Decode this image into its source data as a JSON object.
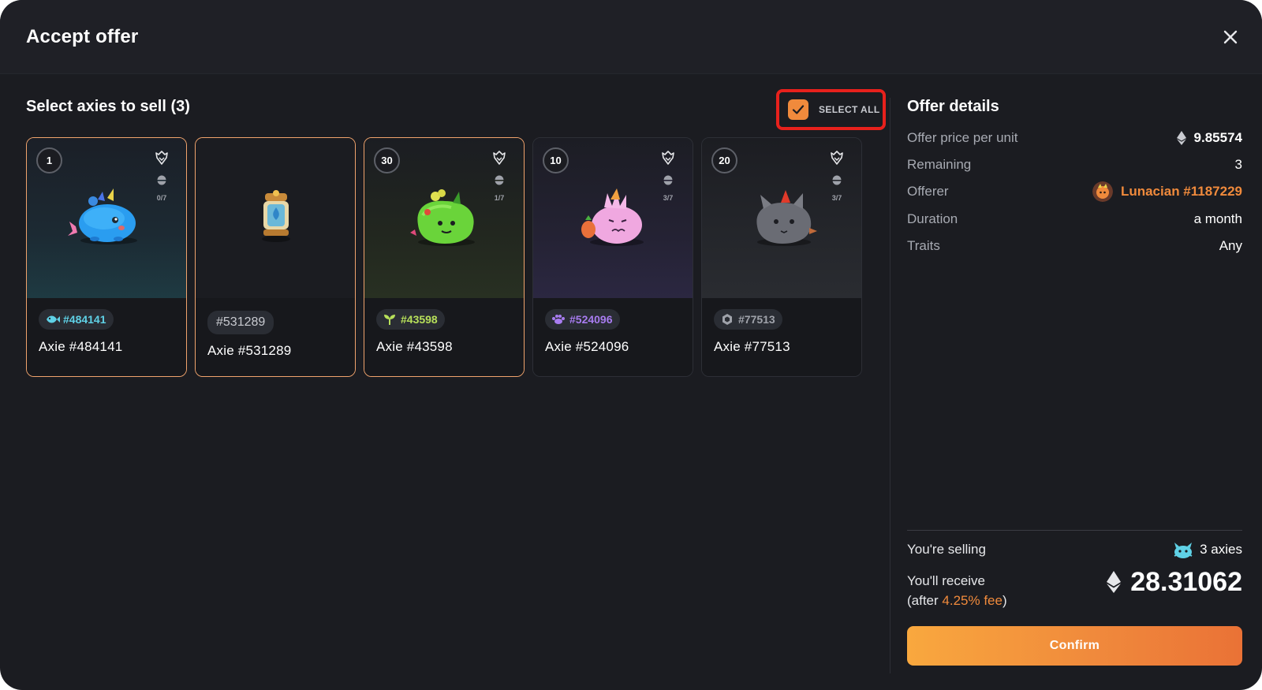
{
  "modal": {
    "title": "Accept offer",
    "close_icon": "close-icon"
  },
  "selection": {
    "title": "Select axies to sell (3)",
    "select_all_label": "SELECT ALL",
    "select_all_checked": true
  },
  "cards": [
    {
      "level": "1",
      "badge_id": "#484141",
      "badge_color": "#5fd1e6",
      "class_icon": "aquatic-fish-icon",
      "name": "Axie #484141",
      "breed_count": "0/7",
      "selected": true,
      "kind": "axie"
    },
    {
      "level": "",
      "badge_id": "#531289",
      "badge_color": "#c8cad0",
      "class_icon": "",
      "name": "Axie #531289",
      "breed_count": "",
      "selected": true,
      "kind": "egg-lantern"
    },
    {
      "level": "30",
      "badge_id": "#43598",
      "badge_color": "#b7e05a",
      "class_icon": "plant-sprout-icon",
      "name": "Axie #43598",
      "breed_count": "1/7",
      "selected": true,
      "kind": "axie"
    },
    {
      "level": "10",
      "badge_id": "#524096",
      "badge_color": "#a87cf0",
      "class_icon": "bug-paw-icon",
      "name": "Axie #524096",
      "breed_count": "3/7",
      "selected": false,
      "kind": "axie"
    },
    {
      "level": "20",
      "badge_id": "#77513",
      "badge_color": "#9fa2aa",
      "class_icon": "mech-hexagon-icon",
      "name": "Axie #77513",
      "breed_count": "3/7",
      "selected": false,
      "kind": "axie"
    }
  ],
  "offer": {
    "title": "Offer details",
    "price_label": "Offer price per unit",
    "price_value": "9.85574",
    "remaining_label": "Remaining",
    "remaining_value": "3",
    "offerer_label": "Offerer",
    "offerer_value": "Lunacian #1187229",
    "duration_label": "Duration",
    "duration_value": "a month",
    "traits_label": "Traits",
    "traits_value": "Any"
  },
  "summary": {
    "selling_label": "You're selling",
    "selling_value": "3 axies",
    "receive_label_line1": "You'll receive",
    "receive_label_prefix": "(after ",
    "fee_pct": "4.25% fee",
    "receive_label_suffix": ")",
    "receive_value": "28.31062",
    "confirm_label": "Confirm"
  },
  "colors": {
    "accent": "#f08a3c",
    "highlight_border": "#e8211c",
    "background": "#1b1c21"
  }
}
